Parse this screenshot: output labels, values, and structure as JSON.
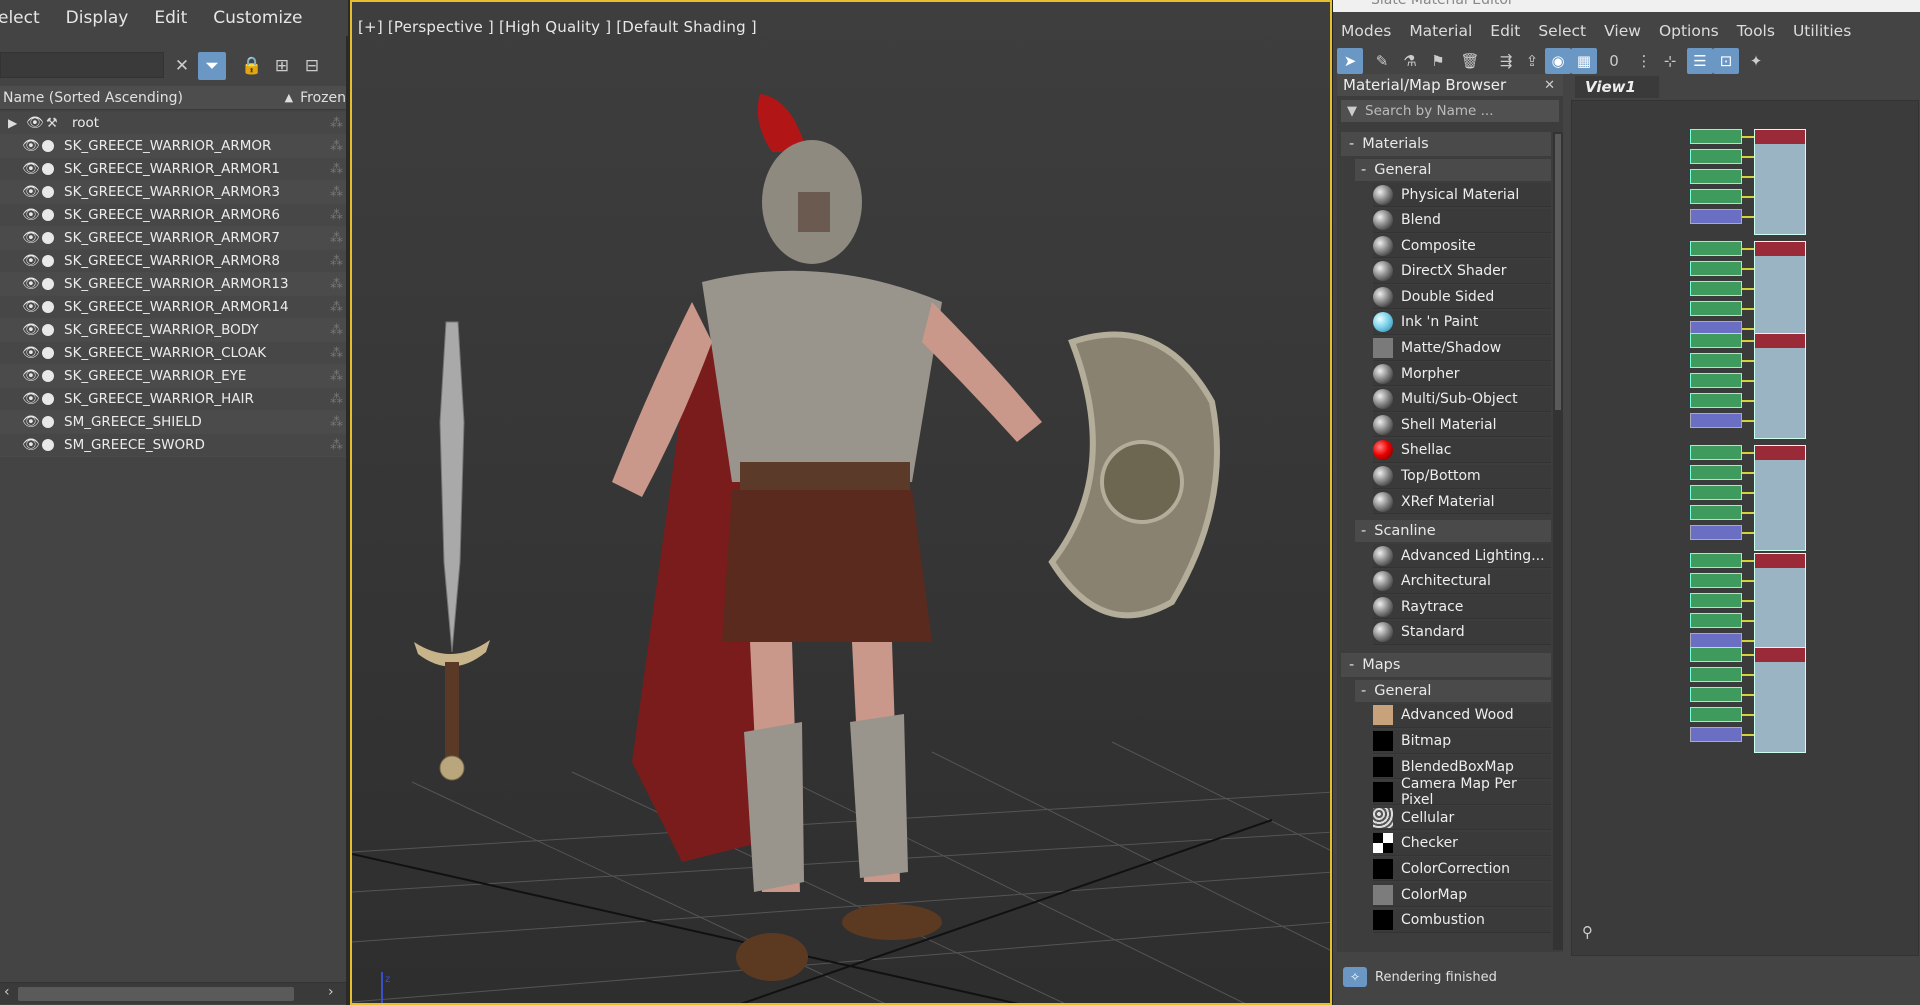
{
  "explorer": {
    "menu": [
      "elect",
      "Display",
      "Edit",
      "Customize"
    ],
    "columns": {
      "name": "Name (Sorted Ascending)",
      "frozen": "Frozen"
    },
    "root": "root",
    "items": [
      "SK_GREECE_WARRIOR_ARMOR",
      "SK_GREECE_WARRIOR_ARMOR1",
      "SK_GREECE_WARRIOR_ARMOR3",
      "SK_GREECE_WARRIOR_ARMOR6",
      "SK_GREECE_WARRIOR_ARMOR7",
      "SK_GREECE_WARRIOR_ARMOR8",
      "SK_GREECE_WARRIOR_ARMOR13",
      "SK_GREECE_WARRIOR_ARMOR14",
      "SK_GREECE_WARRIOR_BODY",
      "SK_GREECE_WARRIOR_CLOAK",
      "SK_GREECE_WARRIOR_EYE",
      "SK_GREECE_WARRIOR_HAIR",
      "SM_GREECE_SHIELD",
      "SM_GREECE_SWORD"
    ]
  },
  "viewport": {
    "label": "[+] [Perspective ] [High Quality ] [Default Shading ]"
  },
  "slate": {
    "title": "Slate Material Editor",
    "menu": [
      "Modes",
      "Material",
      "Edit",
      "Select",
      "View",
      "Options",
      "Tools",
      "Utilities"
    ],
    "browser": {
      "title": "Material/Map Browser",
      "search_placeholder": "Search by Name ...",
      "materials_label": "Materials",
      "general_label": "General",
      "general_items": [
        {
          "label": "Physical Material",
          "swatch": "sphere"
        },
        {
          "label": "Blend",
          "swatch": "sphere"
        },
        {
          "label": "Composite",
          "swatch": "sphere"
        },
        {
          "label": "DirectX Shader",
          "swatch": "sphere"
        },
        {
          "label": "Double Sided",
          "swatch": "sphere"
        },
        {
          "label": "Ink 'n Paint",
          "swatch": "cyan"
        },
        {
          "label": "Matte/Shadow",
          "swatch": "grey"
        },
        {
          "label": "Morpher",
          "swatch": "sphere"
        },
        {
          "label": "Multi/Sub-Object",
          "swatch": "sphere"
        },
        {
          "label": "Shell Material",
          "swatch": "sphere"
        },
        {
          "label": "Shellac",
          "swatch": "red"
        },
        {
          "label": "Top/Bottom",
          "swatch": "sphere"
        },
        {
          "label": "XRef Material",
          "swatch": "sphere"
        }
      ],
      "scanline_label": "Scanline",
      "scanline_items": [
        {
          "label": "Advanced Lighting...",
          "swatch": "sphere"
        },
        {
          "label": "Architectural",
          "swatch": "sphere"
        },
        {
          "label": "Raytrace",
          "swatch": "sphere"
        },
        {
          "label": "Standard",
          "swatch": "sphere"
        }
      ],
      "maps_label": "Maps",
      "maps_general_label": "General",
      "maps_items": [
        {
          "label": "Advanced Wood",
          "swatch": "wood"
        },
        {
          "label": "Bitmap",
          "swatch": "black"
        },
        {
          "label": "BlendedBoxMap",
          "swatch": "black"
        },
        {
          "label": "Camera Map Per Pixel",
          "swatch": "black"
        },
        {
          "label": "Cellular",
          "swatch": "cell"
        },
        {
          "label": "Checker",
          "swatch": "checker"
        },
        {
          "label": "ColorCorrection",
          "swatch": "black"
        },
        {
          "label": "ColorMap",
          "swatch": "gray2"
        },
        {
          "label": "Combustion",
          "swatch": "black"
        }
      ]
    },
    "view_tab": "View1",
    "status": "Rendering finished"
  },
  "colors": {
    "viewport_border": "#e5bf2f",
    "accent": "#6a97c4"
  }
}
